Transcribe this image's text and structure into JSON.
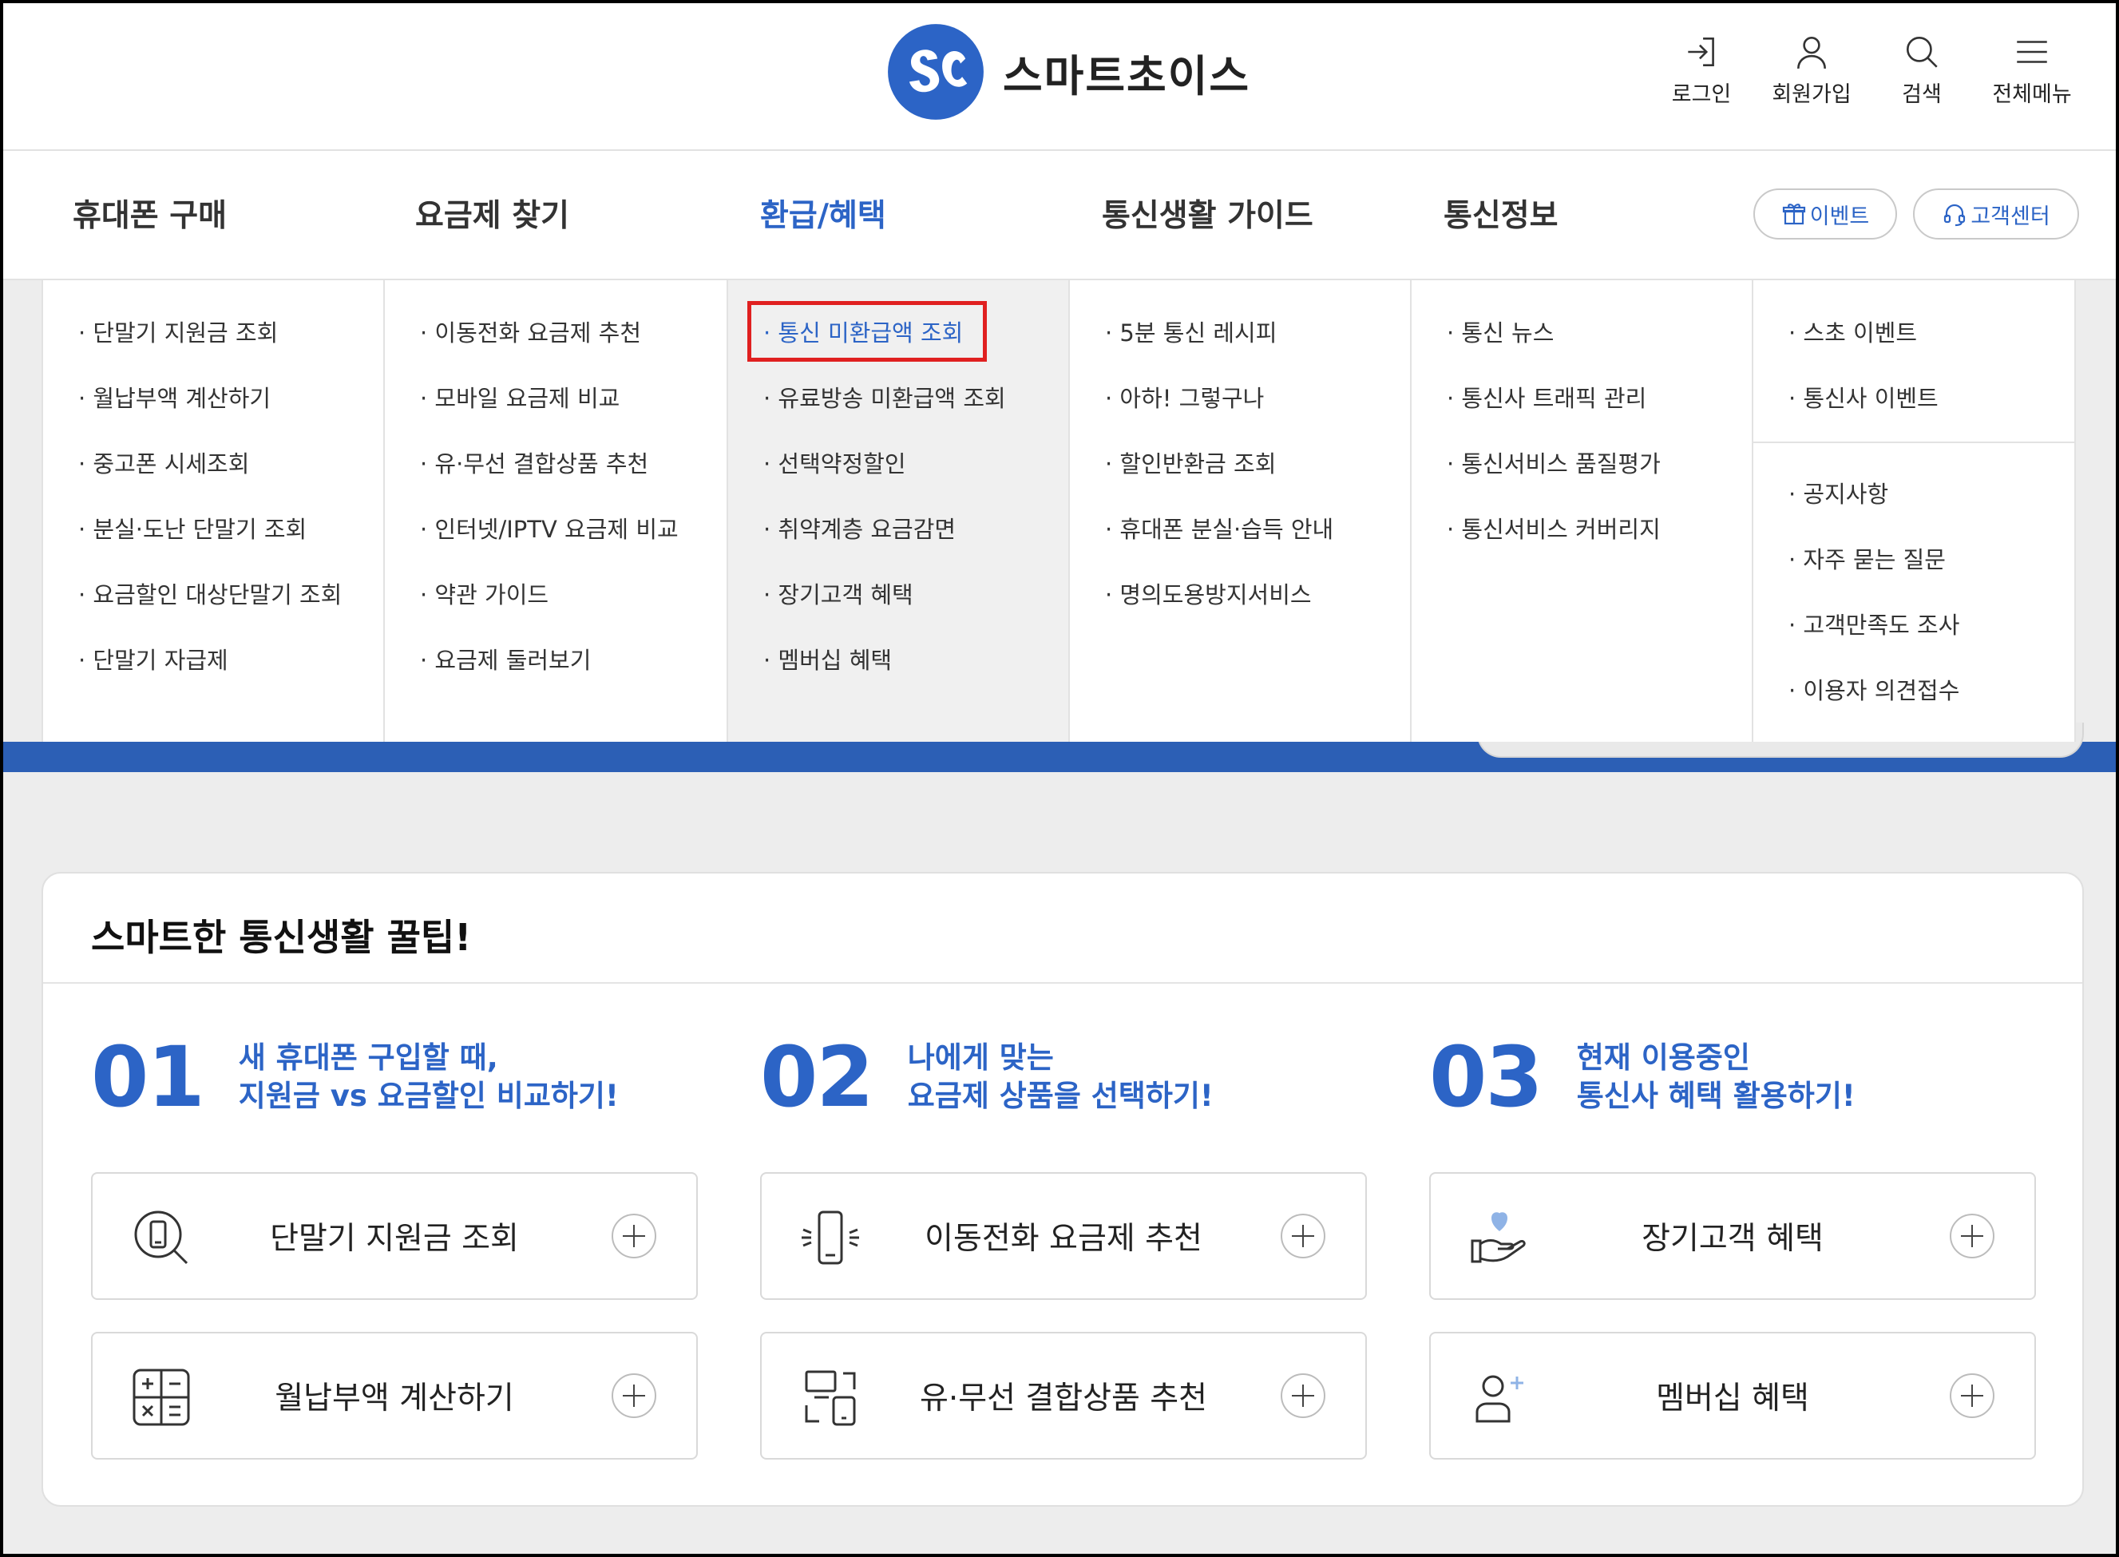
{
  "brand": {
    "name": "스마트초이스",
    "mark_text": "SC"
  },
  "utility": [
    {
      "label": "로그인",
      "icon": "login-icon"
    },
    {
      "label": "회원가입",
      "icon": "user-icon"
    },
    {
      "label": "검색",
      "icon": "search-icon"
    },
    {
      "label": "전체메뉴",
      "icon": "menu-icon"
    }
  ],
  "nav": {
    "items": [
      "휴대폰 구매",
      "요금제 찾기",
      "환급/혜택",
      "통신생활 가이드",
      "통신정보"
    ],
    "active_index": 2,
    "event_label": "이벤트",
    "support_label": "고객센터"
  },
  "mega_menu": {
    "columns": [
      {
        "items": [
          "· 단말기 지원금 조회",
          "· 월납부액 계산하기",
          "· 중고폰 시세조회",
          "· 분실·도난 단말기 조회",
          "· 요금할인 대상단말기 조회",
          "· 단말기 자급제"
        ]
      },
      {
        "items": [
          "· 이동전화 요금제 추천",
          "· 모바일 요금제 비교",
          "· 유·무선 결합상품 추천",
          "· 인터넷/IPTV 요금제 비교",
          "· 약관 가이드",
          "· 요금제 둘러보기"
        ]
      },
      {
        "items": [
          "· 통신 미환급액 조회",
          "· 유료방송 미환급액 조회",
          "· 선택약정할인",
          "· 취약계층 요금감면",
          "· 장기고객 혜택",
          "· 멤버십 혜택"
        ]
      },
      {
        "items": [
          "· 5분 통신 레시피",
          "· 아하! 그렇구나",
          "· 할인반환금 조회",
          "· 휴대폰 분실·습득 안내",
          "· 명의도용방지서비스"
        ]
      },
      {
        "items": [
          "· 통신 뉴스",
          "· 통신사 트래픽 관리",
          "· 통신서비스 품질평가",
          "· 통신서비스 커버리지"
        ]
      },
      {
        "items": [
          "· 스초 이벤트",
          "· 통신사 이벤트"
        ],
        "items2": [
          "· 공지사항",
          "· 자주 묻는 질문",
          "· 고객만족도 조사",
          "· 이용자 의견접수"
        ]
      }
    ],
    "selected": "통신 미환급액 조회"
  },
  "tips": {
    "title": "스마트한 통신생활 꿀팁!",
    "sections": [
      {
        "number": "01",
        "line1": "새 휴대폰 구입할 때,",
        "line2": "지원금 vs 요금할인 비교하기!",
        "tiles": [
          {
            "label": "단말기 지원금 조회",
            "icon": "phone-search-icon"
          },
          {
            "label": "월납부액 계산하기",
            "icon": "calculator-icon"
          }
        ]
      },
      {
        "number": "02",
        "line1": "나에게 맞는",
        "line2": "요금제 상품을 선택하기!",
        "tiles": [
          {
            "label": "이동전화 요금제 추천",
            "icon": "phone-signal-icon"
          },
          {
            "label": "유·무선 결합상품 추천",
            "icon": "devices-icon"
          }
        ]
      },
      {
        "number": "03",
        "line1": "현재 이용중인",
        "line2": "통신사 혜택 활용하기!",
        "tiles": [
          {
            "label": "장기고객 혜택",
            "icon": "heart-hand-icon"
          },
          {
            "label": "멤버십 혜택",
            "icon": "add-user-icon"
          }
        ]
      }
    ]
  },
  "colors": {
    "accent": "#2c64c6",
    "band": "#2c5fb5",
    "highlight": "#e02020"
  }
}
